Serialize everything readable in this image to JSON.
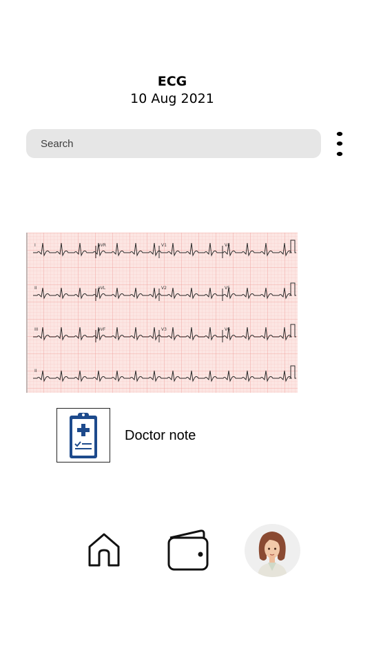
{
  "header": {
    "title": "ECG",
    "date": "10 Aug 2021"
  },
  "search": {
    "placeholder": "Search"
  },
  "menu": {
    "icon": "more-vertical-icon"
  },
  "ecg": {
    "leads": [
      "I",
      "aVR",
      "V1",
      "V4",
      "II",
      "aVL",
      "V2",
      "V5",
      "III",
      "aVF",
      "V3",
      "V6",
      "II"
    ],
    "grid_color": "#f4a9a6",
    "background": "#fce6e3"
  },
  "doctor_note": {
    "label": "Doctor note",
    "icon": "clipboard-medical-icon"
  },
  "nav": {
    "items": [
      {
        "name": "home",
        "icon": "home-icon"
      },
      {
        "name": "wallet",
        "icon": "wallet-icon"
      },
      {
        "name": "profile",
        "icon": "avatar"
      }
    ]
  }
}
